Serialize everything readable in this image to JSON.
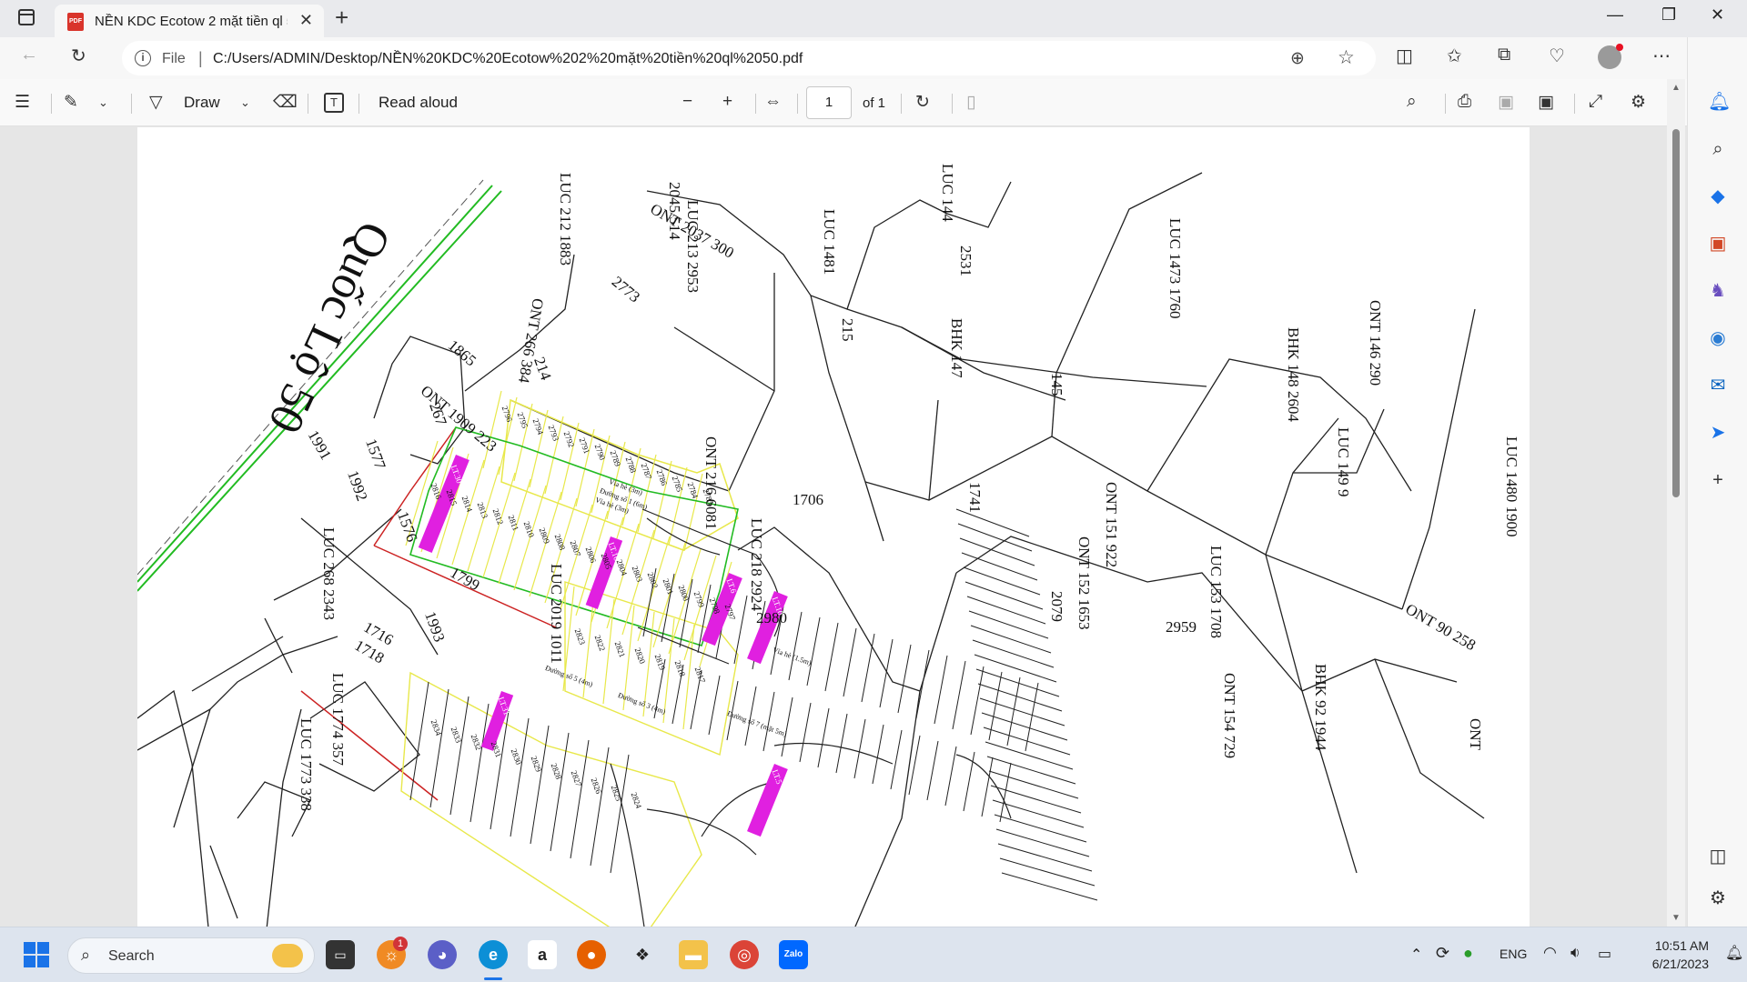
{
  "tab": {
    "title": "NỀN KDC Ecotow 2 mặt tiền ql 50.pdf",
    "favicon_label": "PDF"
  },
  "address": {
    "scheme_label": "File",
    "url": "C:/Users/ADMIN/Desktop/NỀN%20KDC%20Ecotow%202%20mặt%20tiền%20ql%2050.pdf"
  },
  "pdf_toolbar": {
    "draw_label": "Draw",
    "read_aloud_label": "Read aloud",
    "page_number": "1",
    "page_total": "of 1"
  },
  "map": {
    "road_label": "Quốc Lộ 50",
    "parcels": [
      {
        "type": "LUC",
        "num": "212",
        "area": "1883"
      },
      {
        "type": "LUC",
        "num": "213",
        "area": "2953"
      },
      {
        "type": "",
        "num": "2045",
        "area": "514"
      },
      {
        "type": "ONT",
        "num": "2037",
        "area": "300"
      },
      {
        "type": "LUC",
        "num": "1481",
        "area": ""
      },
      {
        "type": "LUC",
        "num": "144",
        "area": ""
      },
      {
        "type": "LUC",
        "num": "1473",
        "area": "1760"
      },
      {
        "type": "",
        "num": "2531",
        "area": ""
      },
      {
        "type": "",
        "num": "2773",
        "area": ""
      },
      {
        "type": "ONT",
        "num": "266",
        "area": "384"
      },
      {
        "type": "",
        "num": "1865",
        "area": ""
      },
      {
        "type": "ONT",
        "num": "1909",
        "area": "223"
      },
      {
        "type": "",
        "num": "214",
        "area": ""
      },
      {
        "type": "",
        "num": "267",
        "area": ""
      },
      {
        "type": "",
        "num": "215",
        "area": ""
      },
      {
        "type": "BHK",
        "num": "147",
        "area": ""
      },
      {
        "type": "",
        "num": "145",
        "area": ""
      },
      {
        "type": "BHK",
        "num": "148",
        "area": "2604"
      },
      {
        "type": "ONT",
        "num": "146",
        "area": "290"
      },
      {
        "type": "ONT",
        "num": "216",
        "area": "6081"
      },
      {
        "type": "LUC",
        "num": "149",
        "area": "9"
      },
      {
        "type": "LUC",
        "num": "1480",
        "area": "1900"
      },
      {
        "type": "",
        "num": "1991",
        "area": ""
      },
      {
        "type": "",
        "num": "1577",
        "area": ""
      },
      {
        "type": "",
        "num": "1992",
        "area": ""
      },
      {
        "type": "",
        "num": "1576",
        "area": ""
      },
      {
        "type": "",
        "num": "1706",
        "area": ""
      },
      {
        "type": "",
        "num": "1741",
        "area": ""
      },
      {
        "type": "LUC",
        "num": "268",
        "area": "2343"
      },
      {
        "type": "",
        "num": "1799",
        "area": ""
      },
      {
        "type": "",
        "num": "1993",
        "area": ""
      },
      {
        "type": "LUC",
        "num": "2019",
        "area": "1011"
      },
      {
        "type": "LUC",
        "num": "218",
        "area": "2924"
      },
      {
        "type": "ONT",
        "num": "151",
        "area": "922"
      },
      {
        "type": "ONT",
        "num": "152",
        "area": "1653"
      },
      {
        "type": "",
        "num": "2959",
        "area": ""
      },
      {
        "type": "LUC",
        "num": "153",
        "area": "1708"
      },
      {
        "type": "ONT",
        "num": "90",
        "area": "258"
      },
      {
        "type": "BHK",
        "num": "92",
        "area": "1944"
      },
      {
        "type": "",
        "num": "1716",
        "area": ""
      },
      {
        "type": "",
        "num": "1718",
        "area": ""
      },
      {
        "type": "LUC",
        "num": "1774",
        "area": "357"
      },
      {
        "type": "LUC",
        "num": "1773",
        "area": "338"
      },
      {
        "type": "",
        "num": "2980",
        "area": ""
      },
      {
        "type": "",
        "num": "2079",
        "area": ""
      },
      {
        "type": "ONT",
        "num": "154",
        "area": "729"
      },
      {
        "type": "ONT",
        "num": "",
        "area": ""
      }
    ],
    "lot_numbers_top": [
      "2796",
      "2795",
      "2794",
      "2793",
      "2792",
      "2791",
      "2790",
      "2789",
      "2788",
      "2787",
      "2786",
      "2785",
      "2784",
      "2783"
    ],
    "lot_numbers_mid": [
      "2816",
      "2815",
      "2814",
      "2813",
      "2812",
      "2811",
      "2810",
      "2809",
      "2808",
      "2807",
      "2806",
      "2805",
      "2804",
      "2803",
      "2802",
      "2801",
      "2800",
      "2799",
      "2798",
      "2797"
    ],
    "lot_numbers_low": [
      "2823",
      "2822",
      "2821",
      "2820",
      "2819",
      "2818",
      "2817"
    ],
    "lot_numbers_bottom": [
      "2834",
      "2833",
      "2832",
      "2831",
      "2830",
      "2829",
      "2828",
      "2827",
      "2826",
      "2825",
      "2824"
    ],
    "highlight_labels": [
      "LT.30",
      "LT.16",
      "LT.6",
      "LT.10",
      "LT.31",
      "LT.5"
    ],
    "street_labels": [
      "Vỉa hè (3m)",
      "Đường số 1 (6m)",
      "Vỉa hè (3m)",
      "Đường số 3 (4m)",
      "Vỉa hè (1.5m)",
      "Đường số 7 (mặt 5m)",
      "Đường số 5 (4m)"
    ]
  },
  "taskbar": {
    "search_label": "Search",
    "language": "ENG",
    "time": "10:51 AM",
    "date": "6/21/2023",
    "badge_count": "1"
  },
  "colors": {
    "highlight": "#e020e0",
    "lot_yellow": "#e8e84a",
    "lot_green": "#22bb22",
    "road_green": "#22bb22",
    "boundary_red": "#cc2222"
  }
}
